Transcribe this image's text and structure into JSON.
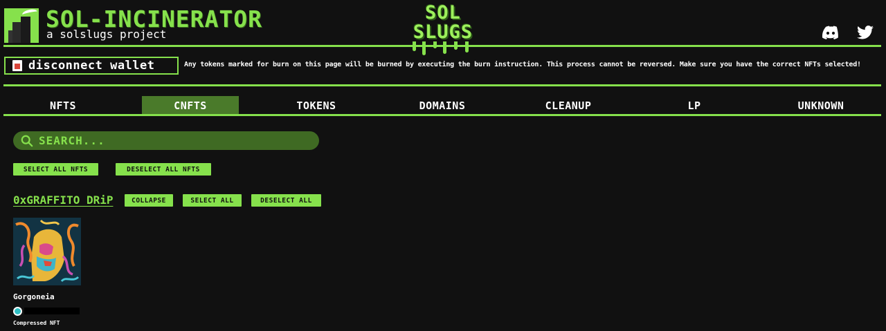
{
  "header": {
    "title": "SOL-INCINERATOR",
    "subtitle": "a solslugs project",
    "brand_line1": "SOL",
    "brand_line2": "SLUGS",
    "discord_icon": "discord-icon",
    "twitter_icon": "twitter-icon"
  },
  "wallet": {
    "button_label": "disconnect wallet",
    "lock_icon": "lock-icon"
  },
  "warning_text": "Any tokens marked for burn on this page will be burned by executing the burn instruction. This process cannot be reversed. Make sure you have the correct NFTs selected!",
  "tabs": [
    {
      "label": "NFTS",
      "active": false
    },
    {
      "label": "CNFTS",
      "active": true
    },
    {
      "label": "TOKENS",
      "active": false
    },
    {
      "label": "DOMAINS",
      "active": false
    },
    {
      "label": "CLEANUP",
      "active": false
    },
    {
      "label": "LP",
      "active": false
    },
    {
      "label": "UNKNOWN",
      "active": false
    }
  ],
  "search": {
    "placeholder": "SEARCH...",
    "value": ""
  },
  "bulk_actions": {
    "select_all": "SELECT ALL NFTS",
    "deselect_all": "DESELECT ALL NFTS"
  },
  "collection": {
    "name": "0xGRAFFITO DRiP",
    "collapse": "COLLAPSE",
    "select_all": "SELECT ALL",
    "deselect_all": "DESELECT ALL",
    "items": [
      {
        "name": "Gorgoneia",
        "type": "Compressed NFT"
      }
    ]
  },
  "colors": {
    "accent": "#86e14c",
    "active_tab": "#4a7a2a",
    "search_bg": "#3f6a23",
    "background": "#111111"
  }
}
